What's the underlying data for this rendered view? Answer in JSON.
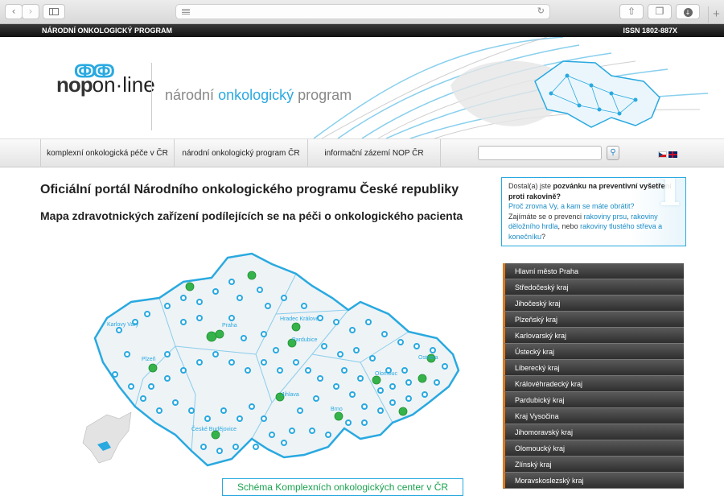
{
  "chrome": {
    "back_icon": "chevron-left",
    "forward_icon": "chevron-right",
    "sidebar_icon": "sidebar",
    "reader_icon": "lines",
    "reload_icon": "reload",
    "share_icon": "share",
    "tabs_icon": "tabs",
    "download_icon": "download",
    "newtab_icon": "plus"
  },
  "topbar": {
    "left": "NÁRODNÍ ONKOLOGICKÝ PROGRAM",
    "right": "ISSN 1802-887X"
  },
  "logo": {
    "nop": "nop",
    "online": "on·line"
  },
  "tagline": {
    "part1": "národní ",
    "highlight": "onkologický",
    "part2": " program"
  },
  "nav": {
    "items": [
      "komplexní onkologická péče v ČR",
      "národní onkologický program ČR",
      "informační zázemí NOP ČR"
    ],
    "search_placeholder": ""
  },
  "main": {
    "title": "Oficiální portál Národního onkologického programu České republiky",
    "subtitle": "Mapa zdravotnických zařízení podílejících se na péči o onkologického pacienta",
    "map_labels": [
      "Praha",
      "Hradec Králové",
      "Pardubice",
      "Karlovy Vary",
      "Plzeň",
      "Jihlava",
      "České Budějovice",
      "Brno",
      "Olomouc",
      "Ostrava"
    ],
    "caption": "Schéma Komplexních onkologických center v ČR"
  },
  "infobox": {
    "line1a": "Dostal(a) jste ",
    "line1b": "pozvánku na preventivní vyšetření proti rakovině?",
    "link1": "Proč zrovna Vy, a kam se máte obrátit?",
    "text2": "Zajímáte se o prevenci ",
    "link2": "rakoviny prsu",
    "link3": "rakoviny děložního hrdla",
    "text3": ", nebo ",
    "link4": "rakoviny tlustého střeva a konečníku",
    "text4": "?"
  },
  "regions": [
    "Hlavní město Praha",
    "Středočeský kraj",
    "Jihočeský kraj",
    "Plzeňský kraj",
    "Karlovarský kraj",
    "Ústecký kraj",
    "Liberecký kraj",
    "Královéhradecký kraj",
    "Pardubický kraj",
    "Kraj Vysočina",
    "Jihomoravský kraj",
    "Olomoucký kraj",
    "Zlínský kraj",
    "Moravskoslezský kraj"
  ],
  "colors": {
    "accent": "#29a9e0",
    "center_green": "#35b34a",
    "region_marker": "#e07a1f"
  }
}
